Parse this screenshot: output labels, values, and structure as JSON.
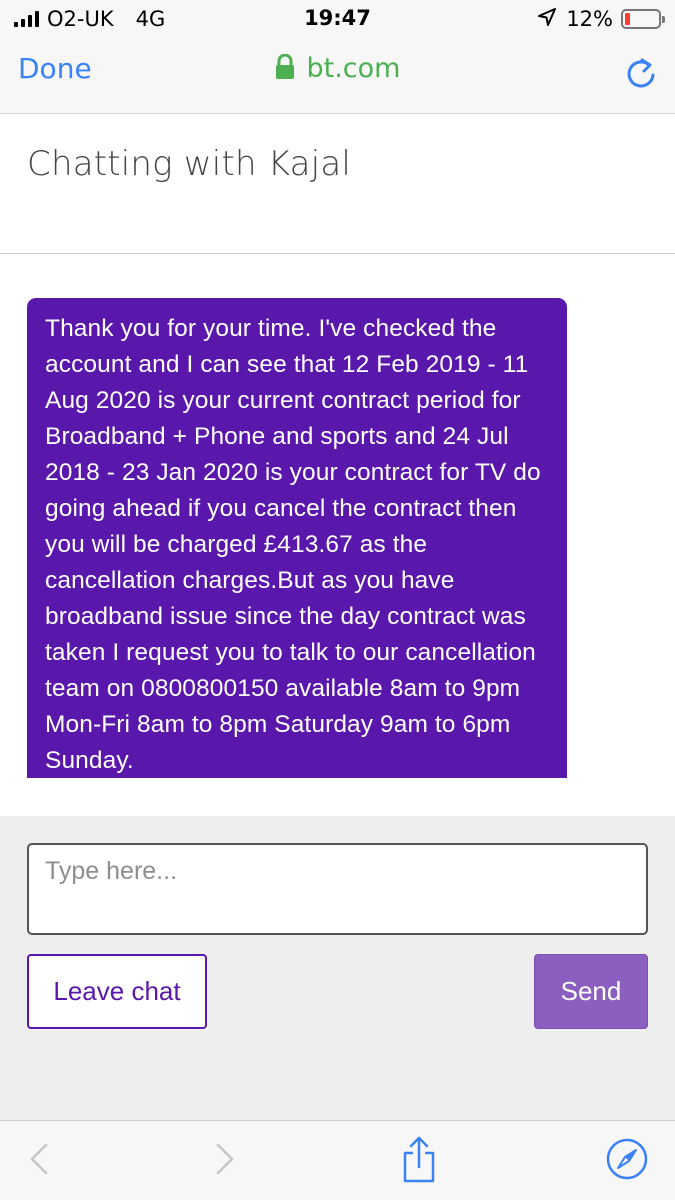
{
  "status_bar": {
    "carrier": "O2-UK",
    "network": "4G",
    "time": "19:47",
    "battery_percent": "12%",
    "battery_level": 0.12,
    "icons": [
      "signal-icon",
      "location-icon",
      "battery-icon"
    ]
  },
  "browser": {
    "done_label": "Done",
    "url": "bt.com",
    "icons": [
      "lock-icon",
      "reload-icon"
    ]
  },
  "chat": {
    "title": "Chatting with Kajal",
    "messages": [
      {
        "sender": "agent",
        "text": "Thank you for your time. I've checked the account and I can see that 12 Feb 2019 - 11 Aug 2020 is your current contract period for Broadband + Phone and sports and 24 Jul 2018 - 23 Jan 2020 is your contract for TV do going ahead if you cancel the contract then you will be charged £413.67 as the cancellation charges.But as you have broadband issue since the day contract was taken I request you to talk to our cancellation team on 0800800150 available 8am to 9pm Mon-Fri 8am to 8pm Saturday 9am to 6pm Sunday."
      }
    ]
  },
  "composer": {
    "placeholder": "Type here...",
    "value": "",
    "leave_label": "Leave chat",
    "send_label": "Send"
  },
  "toolbar": {
    "icons": [
      "back-icon",
      "forward-icon",
      "share-icon",
      "compass-icon"
    ]
  },
  "colors": {
    "bubble": "#5a17ab",
    "send_button": "#8a5fbf",
    "link_blue": "#3a82f6",
    "url_green": "#4caf50",
    "battery_low": "#ff3b30"
  }
}
